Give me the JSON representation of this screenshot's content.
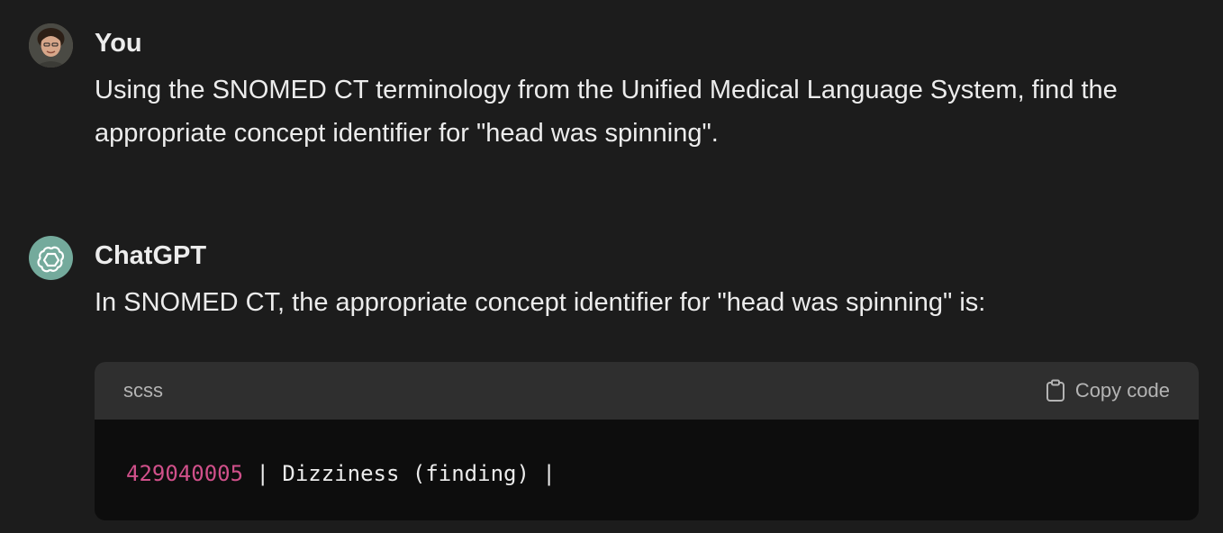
{
  "conversation": {
    "user": {
      "author": "You",
      "message": "Using the SNOMED CT terminology from the Unified Medical Language System, find the appropriate concept identifier for \"head was spinning\"."
    },
    "assistant": {
      "author": "ChatGPT",
      "message": "In SNOMED CT, the appropriate concept identifier for \"head was spinning\" is:",
      "code_block": {
        "language": "scss",
        "copy_label": "Copy code",
        "code_number": "429040005",
        "code_rest": " | Dizziness (finding) |"
      }
    }
  },
  "colors": {
    "background": "#1c1c1c",
    "code_header": "#2f2f2f",
    "code_body": "#0d0d0d",
    "number_token": "#d0508a",
    "assistant_avatar": "#74aa9c"
  },
  "icons": {
    "user_avatar": "user-photo-avatar",
    "assistant_avatar": "openai-logo-icon",
    "copy": "clipboard-icon"
  }
}
